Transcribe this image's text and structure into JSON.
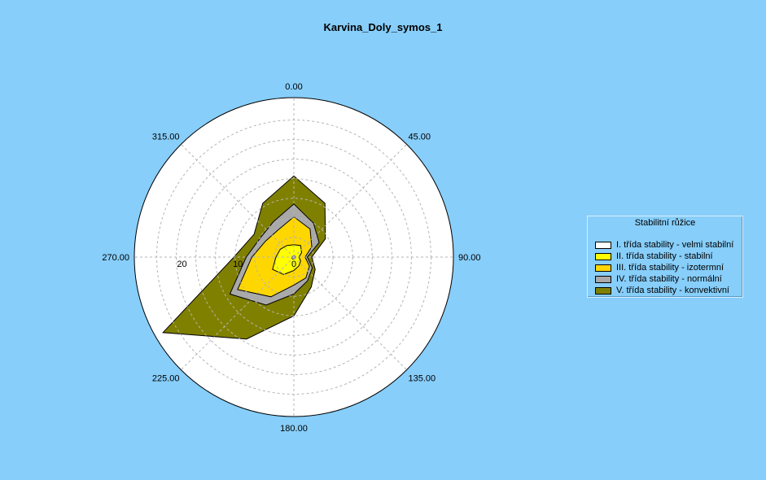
{
  "chart_data": {
    "type": "polar-area",
    "title": "Karvina_Doly_symos_1",
    "angle_labels": [
      "0.00",
      "45.00",
      "90.00",
      "135.00",
      "180.00",
      "225.00",
      "270.00",
      "315.00"
    ],
    "radial_tick_labels": [
      "0",
      "10",
      "20"
    ],
    "rmax": 28.5,
    "legend": {
      "title": "Stabilitní růžice",
      "placement": "right"
    },
    "directions": [
      0,
      30,
      60,
      90,
      120,
      150,
      180,
      210,
      240,
      270,
      300,
      330
    ],
    "series": [
      {
        "name": "I. třída stability - velmi stabilní",
        "color": "#ffffff",
        "values": [
          0.2,
          0.3,
          0.3,
          0.3,
          0.3,
          0.3,
          0.3,
          0.4,
          0.4,
          0.3,
          0.3,
          0.2
        ]
      },
      {
        "name": "II. třída stability - stabilní",
        "color": "#ffff00",
        "values": [
          2.2,
          2.4,
          1.6,
          0.9,
          1.4,
          1.8,
          2.4,
          3.6,
          4.4,
          3.2,
          2.8,
          2.4
        ]
      },
      {
        "name": "III. třída stability - izotermní",
        "color": "#ffd700",
        "values": [
          7.2,
          5.8,
          3.7,
          2.0,
          3.2,
          4.3,
          5.0,
          8.2,
          11.6,
          7.5,
          5.8,
          5.6
        ]
      },
      {
        "name": "IV. třída stability - normální",
        "color": "#a9a9a9",
        "values": [
          9.5,
          7.0,
          5.2,
          2.4,
          3.8,
          4.9,
          6.6,
          9.9,
          13.2,
          8.5,
          6.9,
          7.3
        ]
      },
      {
        "name": "V. třída stability - konvektivní",
        "color": "#808000",
        "values": [
          14.5,
          11.1,
          6.5,
          3.2,
          4.4,
          6.2,
          10.5,
          16.9,
          27.0,
          10.7,
          8.2,
          11.1
        ]
      }
    ]
  }
}
